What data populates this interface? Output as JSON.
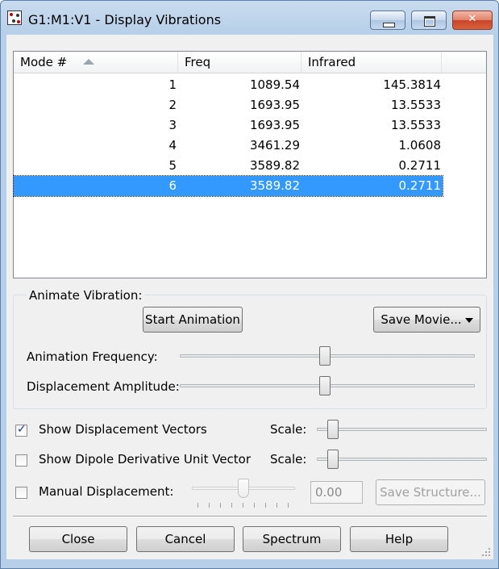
{
  "window": {
    "title": "G1:M1:V1 - Display Vibrations",
    "icons": {
      "app": "molecule-app-icon",
      "minimize": "minimize-icon",
      "maximize": "maximize-icon",
      "close": "close-x-icon"
    }
  },
  "modes_table": {
    "columns": [
      "Mode #",
      "Freq",
      "Infrared"
    ],
    "sort_icon": "sort-ascending-icon",
    "rows": [
      {
        "mode": "1",
        "freq": "1089.54",
        "infrared": "145.3814"
      },
      {
        "mode": "2",
        "freq": "1693.95",
        "infrared": "13.5533"
      },
      {
        "mode": "3",
        "freq": "1693.95",
        "infrared": "13.5533"
      },
      {
        "mode": "4",
        "freq": "3461.29",
        "infrared": "1.0608"
      },
      {
        "mode": "5",
        "freq": "3589.82",
        "infrared": "0.2711"
      },
      {
        "mode": "6",
        "freq": "3589.82",
        "infrared": "0.2711"
      }
    ],
    "selected_row": 6,
    "selection_color": "#3399ff"
  },
  "animate": {
    "group_label": "Animate Vibration:",
    "start_button": "Start Animation",
    "save_movie_button": "Save Movie...",
    "frequency_label": "Animation Frequency:",
    "frequency_level": 0.5,
    "amplitude_label": "Displacement Amplitude:",
    "amplitude_level": 0.5
  },
  "options": {
    "show_vectors": {
      "label": "Show Displacement Vectors",
      "checked": true,
      "scale_label": "Scale:",
      "scale_level": 0.07
    },
    "show_dipole": {
      "label": "Show Dipole Derivative Unit Vector",
      "checked": false,
      "scale_label": "Scale:",
      "scale_level": 0.07
    },
    "manual": {
      "label": "Manual Displacement:",
      "checked": false,
      "slider_level": 0.5,
      "value": "0.00",
      "save_structure_button": "Save Structure..."
    }
  },
  "footer": {
    "close_button": "Close",
    "cancel_button": "Cancel",
    "spectrum_button": "Spectrum",
    "help_button": "Help",
    "resize_icon": "resize-grip-icon"
  }
}
